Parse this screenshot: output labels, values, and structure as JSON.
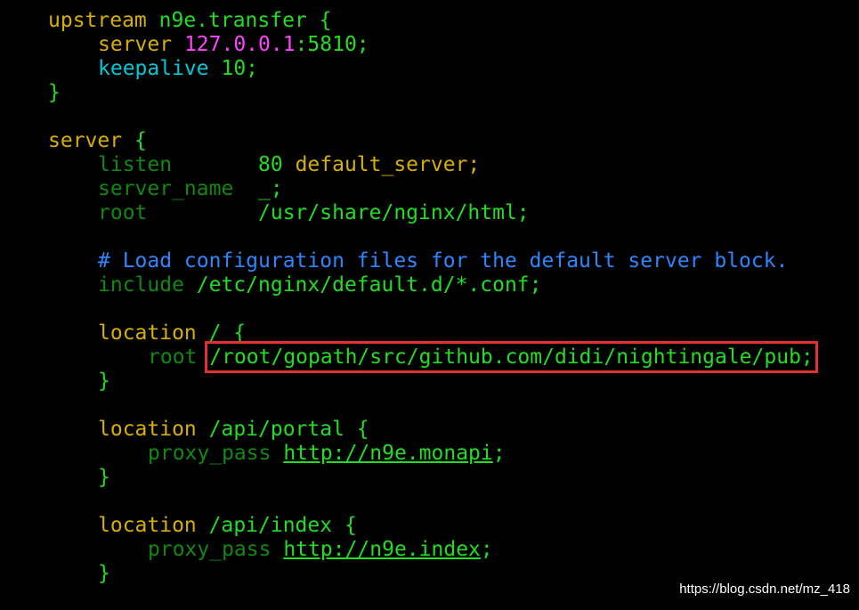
{
  "lines": {
    "l1": {
      "kw": "upstream ",
      "name": "n9e.transfer",
      "brace": " {"
    },
    "l2": {
      "kw": "server ",
      "ip": "127.0.0.1",
      "port": ":5810;"
    },
    "l3": {
      "kw": "keepalive ",
      "val": "10;"
    },
    "l4": {
      "brace": "}"
    },
    "l6": {
      "kw": "server ",
      "brace": "{"
    },
    "l7": {
      "kw": "listen       ",
      "val": "80 ",
      "kw2": "default_server;"
    },
    "l8": {
      "kw": "server_name  ",
      "val": "_;"
    },
    "l9": {
      "kw": "root         ",
      "val": "/usr/share/nginx/html;"
    },
    "l11": {
      "comment": "# Load configuration files for the default server block."
    },
    "l12": {
      "kw": "include ",
      "val": "/etc/nginx/default.d/*.conf;"
    },
    "l14": {
      "kw": "location ",
      "val": "/ {"
    },
    "l15": {
      "kw": "root ",
      "val": "/root/gopath/src/github.com/didi/nightingale/pub;"
    },
    "l16": {
      "brace": "}"
    },
    "l18": {
      "kw": "location ",
      "val": "/api/portal {"
    },
    "l19": {
      "kw": "proxy_pass ",
      "url": "http://n9e.monapi",
      "semi": ";"
    },
    "l20": {
      "brace": "}"
    },
    "l22": {
      "kw": "location ",
      "val": "/api/index {"
    },
    "l23": {
      "kw": "proxy_pass ",
      "url": "http://n9e.index",
      "semi": ";"
    },
    "l24": {
      "brace": "}"
    }
  },
  "watermark": "https://blog.csdn.net/mz_418",
  "colors": {
    "background": "#000000",
    "keyword": "#d7af00",
    "value": "#22dd22",
    "number": "#ff44ff",
    "directive_cyan": "#00c8d7",
    "directive_dim": "#118811",
    "comment": "#2e86ff",
    "highlight_box": "#e03030"
  }
}
